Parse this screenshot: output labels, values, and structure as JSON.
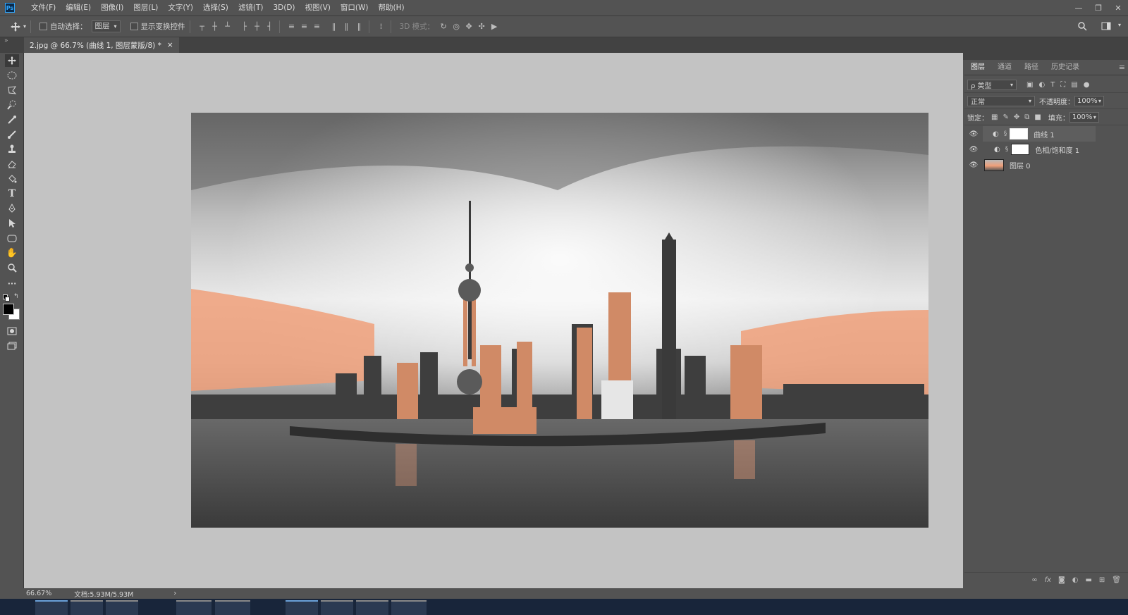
{
  "app": {
    "logo": "Ps"
  },
  "menu": [
    "文件(F)",
    "编辑(E)",
    "图像(I)",
    "图层(L)",
    "文字(Y)",
    "选择(S)",
    "滤镜(T)",
    "3D(D)",
    "视图(V)",
    "窗口(W)",
    "帮助(H)"
  ],
  "window_controls": {
    "minimize": "—",
    "restore": "❐",
    "close": "✕"
  },
  "options": {
    "auto_select_label": "自动选择：",
    "auto_select_value": "图层",
    "show_transform_label": "显示变换控件",
    "mode_3d_label": "3D 模式："
  },
  "document_tab": {
    "title": "2.jpg @ 66.7% (曲线 1, 图层蒙版/8) *",
    "close": "×"
  },
  "status": {
    "zoom": "66.67%",
    "doc_info": "文档:5.93M/5.93M",
    "arrow": "›"
  },
  "panel": {
    "tabs": [
      "图层",
      "通道",
      "路径",
      "历史记录"
    ],
    "menu_icon": "≡",
    "filter_label": "ρ 类型",
    "blend_mode": "正常",
    "opacity_label": "不透明度：",
    "opacity_value": "100%",
    "lock_label": "锁定：",
    "fill_label": "填充：",
    "fill_value": "100%",
    "layers": [
      {
        "name": "曲线 1",
        "type": "adjustment",
        "selected": true
      },
      {
        "name": "色相/饱和度 1",
        "type": "adjustment",
        "selected": false
      },
      {
        "name": "图层 0",
        "type": "image",
        "selected": false
      }
    ],
    "bottom_icons": [
      "link-icon",
      "fx-icon",
      "mask-icon",
      "adjustment-icon",
      "folder-icon",
      "new-layer-icon",
      "trash-icon"
    ],
    "fx_text": "fx"
  },
  "tools": [
    "move-tool",
    "marquee-tool",
    "lasso-tool",
    "quick-select-tool",
    "eyedropper-tool",
    "brush-tool",
    "stamp-tool",
    "eraser-tool",
    "paint-bucket-tool",
    "type-tool",
    "pen-tool",
    "path-select-tool",
    "shape-tool",
    "hand-tool",
    "zoom-tool",
    "more-tools",
    "default-colors",
    "swap-colors",
    "foreground-color",
    "background-color",
    "quick-mask",
    "screen-mode"
  ],
  "type_tool_glyph": "T",
  "more_glyph": "···",
  "colors": {
    "ui_bg": "#535353",
    "canvas_bg": "#c3c3c3",
    "tab_bg": "#424242",
    "accent": "#31a8ff",
    "sunset": "#f0a07a"
  }
}
